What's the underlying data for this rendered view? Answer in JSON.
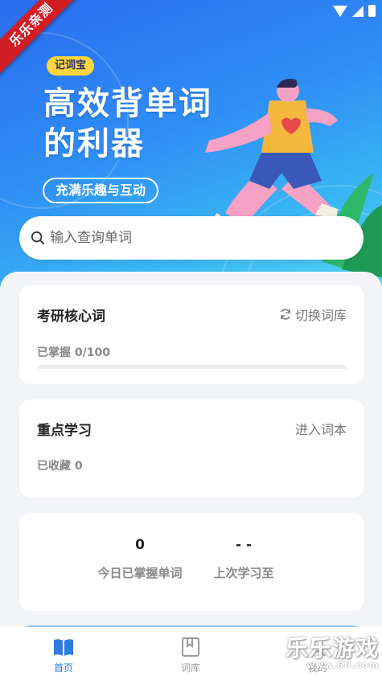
{
  "hero": {
    "ribbon": "乐乐亲测",
    "tag": "记词宝",
    "headline_line1": "高效背单词",
    "headline_line2": "的利器",
    "pill": "充满乐趣与互动"
  },
  "search": {
    "placeholder": "输入查询单词",
    "icon": "search-icon"
  },
  "card_vocab": {
    "title": "考研核心词",
    "action_label": "切换词库",
    "action_icon": "refresh-icon",
    "mastered_text": "已掌握 0/100",
    "progress_fraction": 0
  },
  "card_focus": {
    "title": "重点学习",
    "action_label": "进入词本",
    "favorites_text": "已收藏 0"
  },
  "stats": {
    "today_value": "0",
    "today_label": "今日已掌握单词",
    "last_value": "- -",
    "last_label": "上次学习至"
  },
  "nav": {
    "items": [
      {
        "label": "首页",
        "icon": "book-open-icon",
        "active": true
      },
      {
        "label": "词库",
        "icon": "bookmark-book-icon",
        "active": false
      },
      {
        "label": "我的",
        "icon": "user-icon",
        "active": false
      }
    ]
  },
  "watermark": {
    "main": "乐乐游戏",
    "url": "www.6ll.com"
  },
  "colors": {
    "accent": "#2f7be0",
    "ribbon": "#d11e24",
    "tag": "#ffd63b"
  }
}
